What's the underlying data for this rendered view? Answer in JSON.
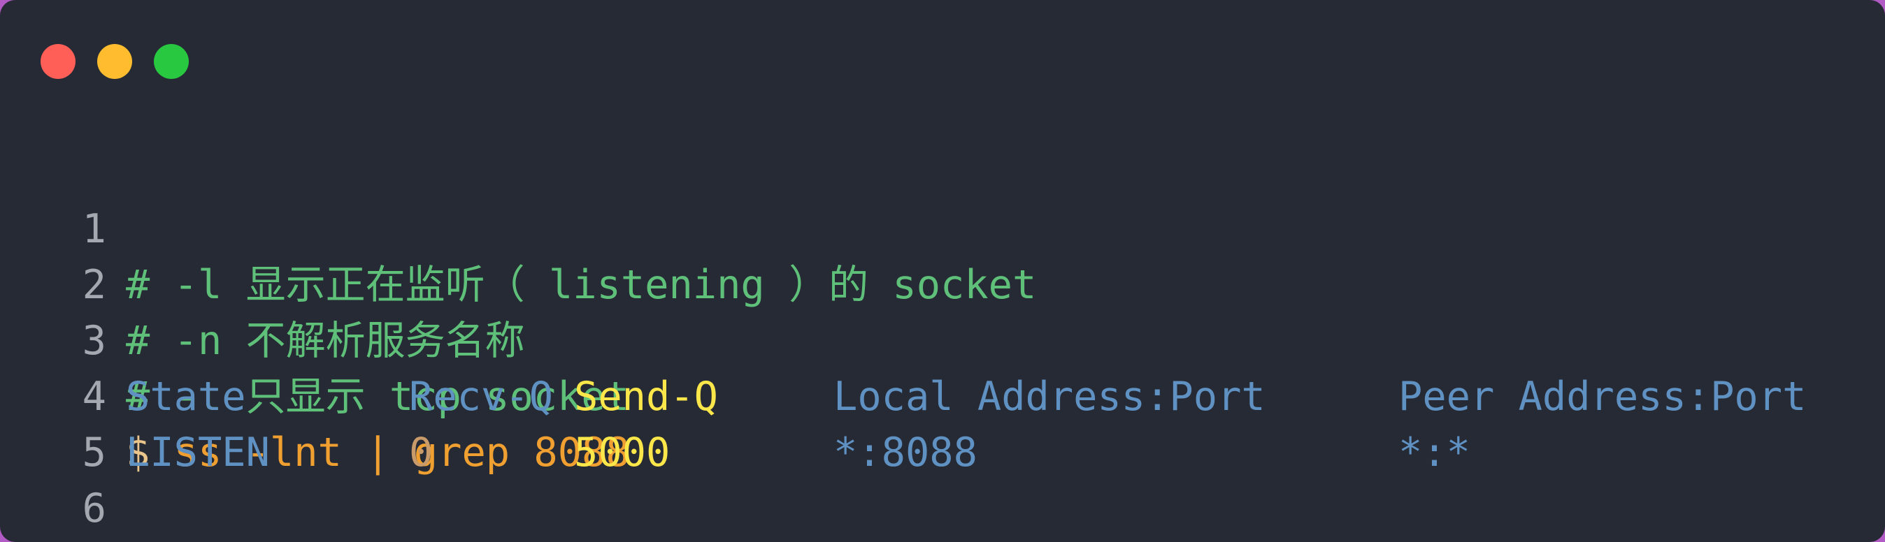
{
  "window": {
    "controls": [
      "close",
      "minimize",
      "maximize"
    ]
  },
  "lines": [
    {
      "num": "1",
      "text": "# -l 显示正在监听（ listening ）的 socket"
    },
    {
      "num": "2",
      "text": "# -n 不解析服务名称"
    },
    {
      "num": "3",
      "text": "# -t 只显示 tcp socket"
    },
    {
      "num": "4",
      "prompt": "$ ",
      "text": "ss -lnt | grep 8088"
    },
    {
      "num": "5",
      "cols": [
        "State",
        "Recv-Q",
        "Send-Q",
        "Local Address:Port",
        "Peer Address:Port"
      ]
    },
    {
      "num": "6",
      "cols": [
        "LISTEN",
        "0",
        "5000",
        "*:8088",
        "*:*"
      ]
    }
  ],
  "colors": {
    "background": "#262a35",
    "comment": "#5fc07a",
    "command": "#f0a030",
    "header": "#5f91c3",
    "highlight": "#fce74a"
  }
}
